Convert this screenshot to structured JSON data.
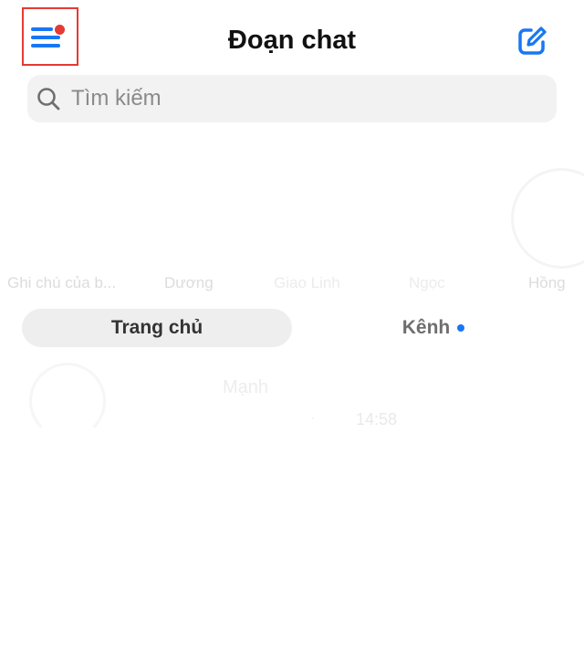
{
  "header": {
    "title": "Đoạn chat",
    "menu_icon": "hamburger-menu-icon",
    "notification_color": "#e53935",
    "compose_icon": "compose-icon",
    "accent_color": "#1877f2"
  },
  "search": {
    "placeholder": "Tìm kiếm",
    "icon": "search-icon"
  },
  "stories": [
    {
      "label": "Ghi chú của b..."
    },
    {
      "label": "Dương"
    },
    {
      "label": "Giao Linh"
    },
    {
      "label": "Ngọc"
    },
    {
      "label": "Hồng"
    }
  ],
  "tabs": [
    {
      "label": "Trang chủ",
      "active": true
    },
    {
      "label": "Kênh",
      "has_dot": true
    }
  ],
  "chats": [
    {
      "name": "Mạnh",
      "time": "14:58"
    }
  ]
}
